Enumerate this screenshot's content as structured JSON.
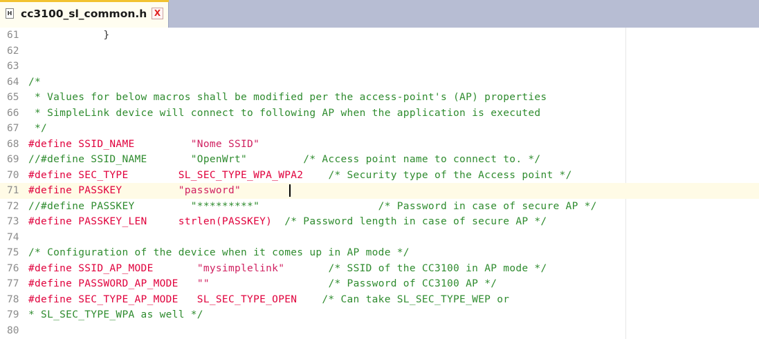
{
  "tab": {
    "title": "cc3100_sl_common.h",
    "icon": "header-file-icon",
    "icon_text": "H",
    "close": "X"
  },
  "lines": [
    {
      "n": "61",
      "segs": [
        {
          "t": "            }",
          "c": "tx"
        }
      ]
    },
    {
      "n": "62",
      "segs": []
    },
    {
      "n": "63",
      "segs": []
    },
    {
      "n": "64",
      "segs": [
        {
          "t": "/*",
          "c": "cm"
        }
      ]
    },
    {
      "n": "65",
      "segs": [
        {
          "t": " * Values for below macros shall be modified per the access-point's (AP) properties",
          "c": "cm"
        }
      ]
    },
    {
      "n": "66",
      "segs": [
        {
          "t": " * SimpleLink device will connect to following AP when the application is executed",
          "c": "cm"
        }
      ]
    },
    {
      "n": "67",
      "segs": [
        {
          "t": " */",
          "c": "cm"
        }
      ]
    },
    {
      "n": "68",
      "segs": [
        {
          "t": "#define SSID_NAME         ",
          "c": "kw"
        },
        {
          "t": "\"Nome SSID\"",
          "c": "str"
        }
      ]
    },
    {
      "n": "69",
      "segs": [
        {
          "t": "//#define SSID_NAME       \"OpenWrt\"         /* Access point name to connect to. */",
          "c": "cm"
        }
      ]
    },
    {
      "n": "70",
      "segs": [
        {
          "t": "#define SEC_TYPE        SL_SEC_TYPE_WPA_WPA2    ",
          "c": "kw"
        },
        {
          "t": "/* Security type of the Access point */",
          "c": "cm"
        }
      ]
    },
    {
      "n": "71",
      "current": true,
      "segs": [
        {
          "t": "#define PASSKEY         ",
          "c": "kw"
        },
        {
          "t": "\"password\"",
          "c": "str"
        }
      ]
    },
    {
      "n": "72",
      "segs": [
        {
          "t": "//#define PASSKEY         \"*********\"                   /* Password in case of secure AP */",
          "c": "cm"
        }
      ]
    },
    {
      "n": "73",
      "segs": [
        {
          "t": "#define PASSKEY_LEN     strlen(PASSKEY)  ",
          "c": "kw"
        },
        {
          "t": "/* Password length in case of secure AP */",
          "c": "cm"
        }
      ]
    },
    {
      "n": "74",
      "segs": []
    },
    {
      "n": "75",
      "segs": [
        {
          "t": "/* Configuration of the device when it comes up in AP mode */",
          "c": "cm"
        }
      ]
    },
    {
      "n": "76",
      "segs": [
        {
          "t": "#define SSID_AP_MODE       ",
          "c": "kw"
        },
        {
          "t": "\"mysimplelink\"",
          "c": "str"
        },
        {
          "t": "       ",
          "c": "tx"
        },
        {
          "t": "/* SSID of the CC3100 in AP mode */",
          "c": "cm"
        }
      ]
    },
    {
      "n": "77",
      "segs": [
        {
          "t": "#define PASSWORD_AP_MODE   ",
          "c": "kw"
        },
        {
          "t": "\"\"",
          "c": "str"
        },
        {
          "t": "                   ",
          "c": "tx"
        },
        {
          "t": "/* Password of CC3100 AP */",
          "c": "cm"
        }
      ]
    },
    {
      "n": "78",
      "segs": [
        {
          "t": "#define SEC_TYPE_AP_MODE   SL_SEC_TYPE_OPEN    ",
          "c": "kw"
        },
        {
          "t": "/* Can take SL_SEC_TYPE_WEP or",
          "c": "cm"
        }
      ]
    },
    {
      "n": "79",
      "segs": [
        {
          "t": "* SL_SEC_TYPE_WPA as well */",
          "c": "cm"
        }
      ]
    },
    {
      "n": "80",
      "segs": []
    }
  ]
}
